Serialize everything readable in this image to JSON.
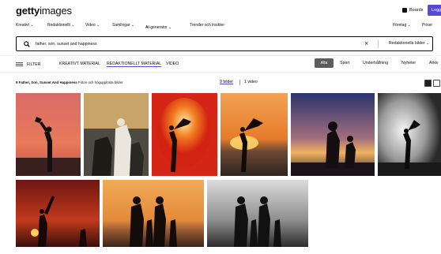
{
  "header": {
    "logo_bold": "getty",
    "logo_light": "images",
    "boards_label": "Boards",
    "login_label": "Logga"
  },
  "nav": {
    "left_items": [
      "Kreativt ⌄",
      "Redaktionellt ⌄",
      "Video ⌄",
      "Samlingar ⌄",
      "AI-generator ⌄",
      "Trender och insikter"
    ],
    "right_items": [
      "Företag ⌄",
      "Priser"
    ]
  },
  "search": {
    "query": "father, son, sunset and happiness",
    "clear_icon": "close-icon",
    "scope_label": "Redaktionella bilder ⌄"
  },
  "filters": {
    "filter_label": "FILTER",
    "tabs": [
      "KREATIVT MATERIAL",
      "REDAKTIONELLT MATERIAL",
      "VIDEO"
    ],
    "active_tab": "REDAKTIONELLT MATERIAL",
    "chips": [
      "Alla",
      "Sport",
      "Underhållning",
      "Nyheter",
      "Arkiv"
    ],
    "active_chip": "Alla"
  },
  "results": {
    "title": "9 Father, Son, Sunset And Happiness",
    "subtitle": " Foton och högupplösta bilder",
    "images_count": "9 bilder",
    "video_count": "1 video"
  },
  "colors": {
    "accent": "#5949d9",
    "filter_icon": "#1b5cff"
  }
}
